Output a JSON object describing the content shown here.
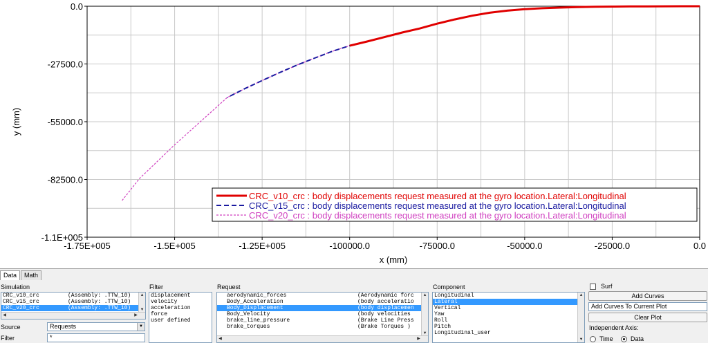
{
  "chart_data": {
    "type": "line",
    "title": "",
    "xlabel": "x (mm)",
    "ylabel": "y (mm)",
    "xlim": [
      -175000,
      0
    ],
    "ylim": [
      -110000,
      0
    ],
    "x_ticks": [
      -175000,
      -150000,
      -125000,
      -100000,
      -75000,
      -50000,
      -25000,
      0
    ],
    "x_tick_labels": [
      "-1.75E+005",
      "-1.5E+005",
      "-1.25E+005",
      "-100000.0",
      "-75000.0",
      "-50000.0",
      "-25000.0",
      "0.0"
    ],
    "y_ticks": [
      0,
      -27500,
      -55000,
      -82500,
      -110000
    ],
    "y_tick_labels": [
      "0.0",
      "-27500.0",
      "-55000.0",
      "-82500.0",
      "-1.1E+005"
    ],
    "grid": true,
    "legend_position": "bottom-right",
    "series": [
      {
        "name": "CRC_v10_crc : body displacements request measured at the gyro location.Lateral:Longitudinal",
        "color": "#e00000",
        "style": "solid",
        "x": [
          0,
          -5000,
          -10000,
          -15000,
          -20000,
          -25000,
          -30000,
          -35000,
          -40000,
          -45000,
          -50000,
          -55000,
          -60000,
          -65000,
          -70000,
          -75000,
          -80000,
          -85000,
          -90000,
          -95000,
          -100000
        ],
        "y": [
          0,
          -10,
          -30,
          -60,
          -100,
          -150,
          -250,
          -420,
          -650,
          -950,
          -1400,
          -2100,
          -3100,
          -4500,
          -6300,
          -8300,
          -10600,
          -12500,
          -14700,
          -16800,
          -18800
        ]
      },
      {
        "name": "CRC_v15_crc : body displacements request measured at the gyro location.Lateral:Longitudinal",
        "color": "#1a1aa0",
        "style": "dashed",
        "x": [
          0,
          -5000,
          -10000,
          -15000,
          -20000,
          -25000,
          -30000,
          -35000,
          -40000,
          -45000,
          -50000,
          -55000,
          -60000,
          -65000,
          -70000,
          -75000,
          -80000,
          -85000,
          -90000,
          -95000,
          -100000,
          -105000,
          -110000,
          -115000,
          -120000,
          -125000,
          -130000,
          -135000
        ],
        "y": [
          0,
          -10,
          -30,
          -60,
          -100,
          -150,
          -250,
          -420,
          -650,
          -950,
          -1400,
          -2100,
          -3100,
          -4500,
          -6300,
          -8300,
          -10600,
          -12500,
          -14700,
          -16800,
          -18800,
          -21500,
          -24700,
          -28000,
          -31600,
          -35400,
          -39300,
          -43500
        ]
      },
      {
        "name": "CRC_v20_crc : body displacements request measured at the gyro location.Lateral:Longitudinal",
        "color": "#d040c0",
        "style": "dotted",
        "x": [
          0,
          -5000,
          -10000,
          -15000,
          -20000,
          -25000,
          -30000,
          -35000,
          -40000,
          -45000,
          -50000,
          -55000,
          -60000,
          -65000,
          -70000,
          -75000,
          -80000,
          -85000,
          -90000,
          -95000,
          -100000,
          -105000,
          -110000,
          -115000,
          -120000,
          -125000,
          -130000,
          -135000,
          -140000,
          -145000,
          -150000,
          -155000,
          -160000,
          -165000
        ],
        "y": [
          0,
          -10,
          -30,
          -60,
          -100,
          -150,
          -250,
          -420,
          -650,
          -950,
          -1400,
          -2100,
          -3100,
          -4500,
          -6300,
          -8300,
          -10600,
          -12500,
          -14700,
          -16800,
          -18800,
          -21500,
          -24700,
          -28000,
          -31600,
          -35400,
          -39300,
          -43500,
          -51000,
          -58500,
          -66000,
          -74000,
          -82000,
          -92500
        ]
      }
    ]
  },
  "panel": {
    "tabs": [
      "Data",
      "Math"
    ],
    "simulation": {
      "label": "Simulation",
      "items": [
        {
          "name": "CRC_v10_crc",
          "detail": "(Assembly: .TTW_10)",
          "selected": false
        },
        {
          "name": "CRC_v15_crc",
          "detail": "(Assembly: .TTW_10)",
          "selected": false
        },
        {
          "name": "CRC_v20_crc",
          "detail": "(Assembly: .TTW_10)",
          "selected": true
        }
      ]
    },
    "source": {
      "label": "Source",
      "value": "Requests"
    },
    "filter_field": {
      "label": "Filter",
      "value": "*"
    },
    "filter": {
      "label": "Filter",
      "items": [
        "displacement",
        "velocity",
        "acceleration",
        "force",
        "user defined"
      ]
    },
    "request": {
      "label": "Request",
      "items": [
        {
          "name": "aerodynamic_forces",
          "detail": "(Aerodynamic forc",
          "selected": false
        },
        {
          "name": "Body_Acceleration",
          "detail": "(body acceleratio",
          "selected": false
        },
        {
          "name": "Body_Displacement",
          "detail": "(body displacemen",
          "selected": true
        },
        {
          "name": "Body_Velocity",
          "detail": "(body velocities",
          "selected": false
        },
        {
          "name": "brake_line_pressure",
          "detail": "(Brake Line Press",
          "selected": false
        },
        {
          "name": "brake_torques",
          "detail": "(Brake Torques )",
          "selected": false
        }
      ]
    },
    "component": {
      "label": "Component",
      "items": [
        {
          "name": "Longitudinal",
          "selected": false
        },
        {
          "name": "Lateral",
          "selected": true
        },
        {
          "name": "Vertical",
          "selected": false
        },
        {
          "name": "Yaw",
          "selected": false
        },
        {
          "name": "Roll",
          "selected": false
        },
        {
          "name": "Pitch",
          "selected": false
        },
        {
          "name": "Longitudinal_user",
          "selected": false
        }
      ]
    },
    "right": {
      "surf_label": "Surf",
      "add_curves_label": "Add Curves",
      "add_mode_value": "Add Curves To Current Plot",
      "clear_plot_label": "Clear Plot",
      "independent_axis_label": "Independent Axis:",
      "time_label": "Time",
      "data_label": "Data",
      "independent_axis_selected": "Data"
    }
  }
}
